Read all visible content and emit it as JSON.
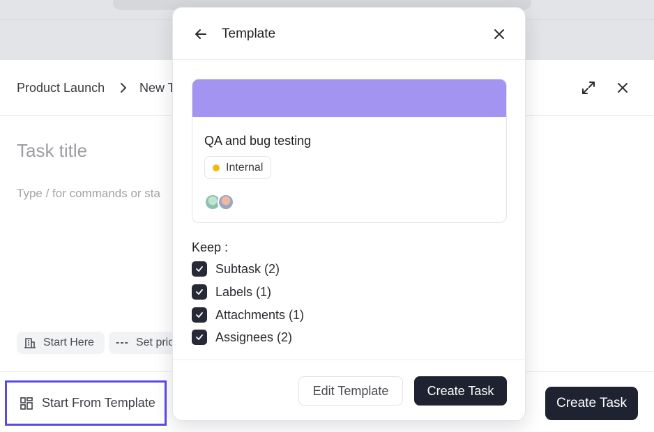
{
  "panel": {
    "breadcrumb": {
      "project": "Product Launch",
      "current": "New T"
    },
    "task_title_placeholder": "Task title",
    "description_placeholder": "Type / for commands or sta",
    "chips": {
      "start": "Start Here",
      "priority": "Set prio"
    },
    "start_from_template_label": "Start From Template",
    "create_task_label": "Create Task"
  },
  "modal": {
    "title": "Template",
    "card": {
      "title": "QA and bug testing",
      "label": "Internal",
      "label_color": "#f2b90f",
      "cover_color": "#a394f1"
    },
    "keep_label": "Keep :",
    "keep_items": [
      {
        "label": "Subtask (2)",
        "checked": true
      },
      {
        "label": "Labels (1)",
        "checked": true
      },
      {
        "label": "Attachments (1)",
        "checked": true
      },
      {
        "label": "Assignees (2)",
        "checked": true
      }
    ],
    "edit_template_label": "Edit Template",
    "create_task_label": "Create Task"
  },
  "colors": {
    "primary_dark": "#1f2231",
    "accent_highlight": "#5a4be0"
  }
}
